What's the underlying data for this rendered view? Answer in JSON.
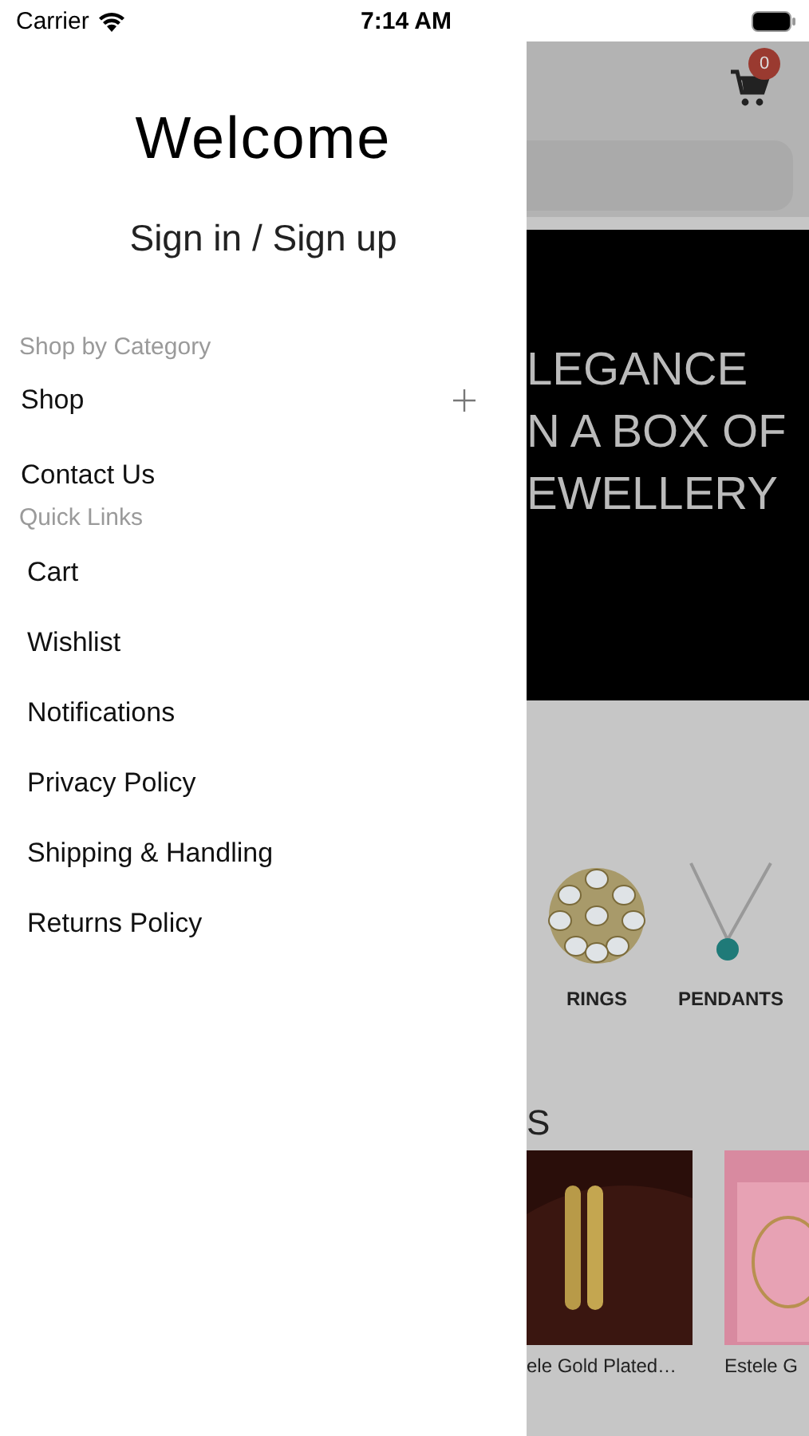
{
  "status_bar": {
    "carrier": "Carrier",
    "time": "7:14 AM"
  },
  "drawer": {
    "title": "Welcome",
    "sign_in": "Sign in / Sign up",
    "sections": [
      {
        "heading": "Shop by Category",
        "items": [
          {
            "label": "Shop",
            "expandable": true
          },
          {
            "label": "Contact Us",
            "expandable": false
          }
        ]
      },
      {
        "heading": "Quick Links",
        "items": [
          {
            "label": "Cart",
            "expandable": false
          },
          {
            "label": "Wishlist",
            "expandable": false
          },
          {
            "label": "Notifications",
            "expandable": false
          },
          {
            "label": "Privacy Policy",
            "expandable": false
          },
          {
            "label": "Shipping & Handling",
            "expandable": false
          },
          {
            "label": "Returns Policy",
            "expandable": false
          }
        ]
      }
    ]
  },
  "background_page": {
    "cart_count": "0",
    "banner_lines": [
      "LEGANCE",
      "N A BOX OF",
      "EWELLERY"
    ],
    "categories": [
      {
        "label": "RINGS"
      },
      {
        "label": "PENDANTS"
      }
    ],
    "section_title": "S",
    "products": [
      {
        "name": "ele Gold Plated…"
      },
      {
        "name": "Estele G"
      }
    ]
  }
}
